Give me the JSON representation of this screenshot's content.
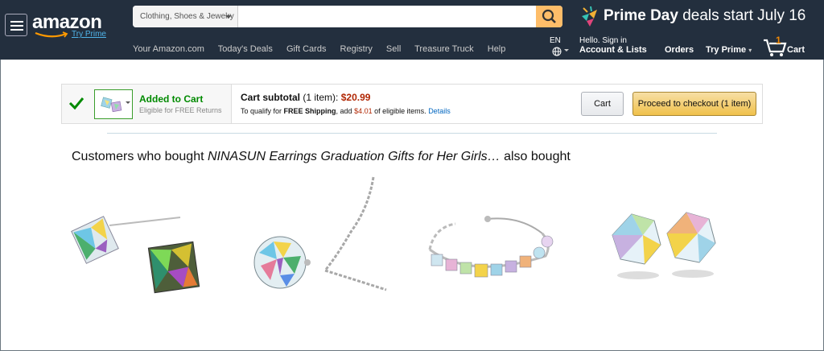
{
  "header": {
    "logo": "amazon",
    "try_prime": "Try Prime",
    "search": {
      "category": "Clothing, Shoes & Jewelry",
      "placeholder": "",
      "value": ""
    },
    "prime_day": {
      "bold": "Prime Day",
      "rest": " deals start July 16"
    },
    "nav_links": [
      "Your Amazon.com",
      "Today's Deals",
      "Gift Cards",
      "Registry",
      "Sell",
      "Treasure Truck",
      "Help"
    ],
    "language": "EN",
    "account": {
      "hello": "Hello. Sign in",
      "main": "Account & Lists"
    },
    "orders": "Orders",
    "try_prime_menu": "Try Prime",
    "cart": {
      "count": "1",
      "label": "Cart"
    },
    "colors": {
      "nav_bg": "#232f3e",
      "search_button": "#febd69",
      "cart_count": "#f08804"
    }
  },
  "added_to_cart": {
    "title": "Added to Cart",
    "subtitle": "Eligible for FREE Returns",
    "subtotal_label": "Cart subtotal",
    "subtotal_items": "(1 item):",
    "subtotal_price": "$20.99",
    "qualify_prefix": "To qualify for",
    "qualify_free": "FREE Shipping",
    "qualify_mid": ", add",
    "qualify_amount": "$4.01",
    "qualify_suffix": "of eligible items.",
    "details_link": "Details",
    "cart_button": "Cart",
    "checkout_button": "Proceed to checkout (1 item)"
  },
  "also_bought": {
    "prefix": "Customers who bought ",
    "product_name": "NINASUN Earrings Graduation Gifts for Her Girls…",
    "suffix": " also bought",
    "products": [
      {
        "icon": "cube-crystal-earrings-image"
      },
      {
        "icon": "crystal-ball-necklace-image"
      },
      {
        "icon": "crystal-bracelet-image"
      },
      {
        "icon": "hexagon-crystal-earrings-image"
      }
    ]
  }
}
